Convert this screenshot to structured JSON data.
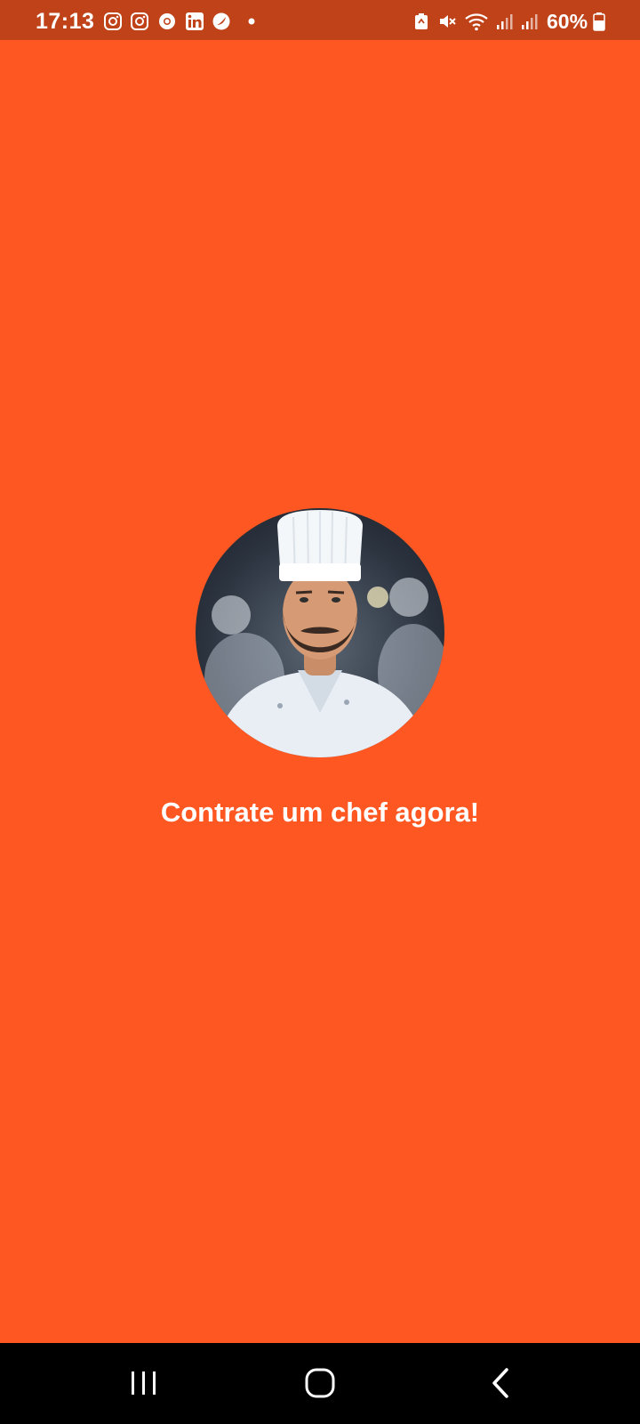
{
  "status_bar": {
    "time": "17:13",
    "notification_icons": [
      "instagram-icon",
      "instagram-icon",
      "chrome-icon",
      "linkedin-icon",
      "app-icon",
      "dot-icon"
    ],
    "system_icons": [
      "battery-saver-icon",
      "mute-icon",
      "wifi-icon",
      "signal-icon",
      "signal-icon"
    ],
    "battery_percent": "60%"
  },
  "splash": {
    "background_color": "#ff5722",
    "avatar_icon": "chef-photo",
    "tagline": "Contrate um chef agora!"
  },
  "nav_bar": {
    "buttons": [
      "recent-apps-icon",
      "home-icon",
      "back-icon"
    ]
  }
}
